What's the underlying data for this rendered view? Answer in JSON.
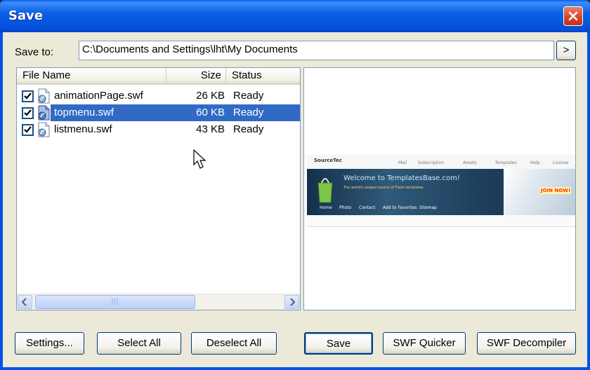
{
  "window": {
    "title": "Save"
  },
  "save_to": {
    "label": "Save to:",
    "path": "C:\\Documents and Settings\\lht\\My Documents",
    "browse_label": ">"
  },
  "file_list": {
    "columns": [
      "File Name",
      "Size",
      "Status"
    ],
    "rows": [
      {
        "name": "animationPage.swf",
        "size": "26 KB",
        "status": "Ready",
        "checked": true,
        "selected": false
      },
      {
        "name": "topmenu.swf",
        "size": "60 KB",
        "status": "Ready",
        "checked": true,
        "selected": true
      },
      {
        "name": "listmenu.swf",
        "size": "43 KB",
        "status": "Ready",
        "checked": true,
        "selected": false
      }
    ]
  },
  "preview": {
    "logo": "SourceTec",
    "nav": [
      "Mail",
      "Subscription",
      "Assets",
      "Templates",
      "Help",
      "License"
    ],
    "headline": "Welcome to TemplatesBase.com!",
    "subtext": "The world's largest source of Flash templates.",
    "bottom_links": [
      "Home",
      "Photo",
      "Contact",
      "Add to Favorites",
      "Sitemap"
    ],
    "join": "JOIN NOW!"
  },
  "buttons": {
    "settings": "Settings...",
    "select_all": "Select All",
    "deselect_all": "Deselect All",
    "save": "Save",
    "swf_quicker": "SWF Quicker",
    "swf_decompiler": "SWF Decompiler"
  },
  "colors": {
    "title_bar": "#0054e3",
    "selection": "#316ac5",
    "dialog_bg": "#ece9d8",
    "close_button": "#d4442a"
  }
}
